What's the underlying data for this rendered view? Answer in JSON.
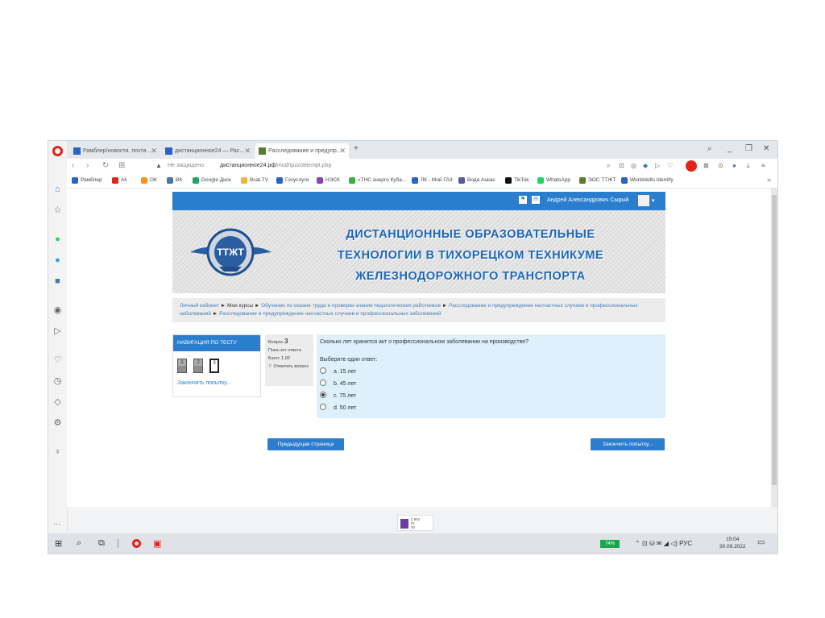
{
  "browser": {
    "tabs": [
      {
        "label": "Рамблер/новости, почта ..."
      },
      {
        "label": "дистанционное24 — Рас..."
      },
      {
        "label": "Расследование и предупр..."
      }
    ],
    "address": {
      "not_secure": "Не защищено",
      "url_domain": "дистанционное24.рф",
      "url_path": "/mod/quiz/attempt.php"
    },
    "bookmarks": [
      {
        "label": "Рамблер",
        "color": "#2c62c4"
      },
      {
        "label": "Ali",
        "color": "#e2231a"
      },
      {
        "label": "ОК",
        "color": "#f7931e"
      },
      {
        "label": "ВК",
        "color": "#4a76a8"
      },
      {
        "label": "Google Диск",
        "color": "#1fa463"
      },
      {
        "label": "Bsat.TV",
        "color": "#f2b632"
      },
      {
        "label": "Госуслуги",
        "color": "#2c62c4"
      },
      {
        "label": "НЭСК",
        "color": "#8e44ad"
      },
      {
        "label": "«ТНС энерго Куба...",
        "color": "#3cb043"
      },
      {
        "label": "ЛК - Мой ГАЗ",
        "color": "#2c62c4"
      },
      {
        "label": "Вода Анкас",
        "color": "#5b5b9c"
      },
      {
        "label": "TikTok",
        "color": "#111111"
      },
      {
        "label": "WhatsApp",
        "color": "#25d366"
      },
      {
        "label": "ЭОС ТТЖТ",
        "color": "#5a7d2a"
      },
      {
        "label": "Worldskills Identify",
        "color": "#2c62c4"
      }
    ]
  },
  "site": {
    "user_name": "Андрей Александрович Сырый",
    "banner_title": [
      "ДИСТАНЦИОННЫЕ ОБРАЗОВАТЕЛЬНЫЕ",
      "ТЕХНОЛОГИИ В ТИХОРЕЦКОМ ТЕХНИКУМЕ",
      "ЖЕЛЕЗНОДОРОЖНОГО ТРАНСПОРТА"
    ],
    "logo_text": "ТТЖТ",
    "breadcrumb": {
      "home": "Личный кабинет",
      "my_courses": "Мои курсы",
      "course": "Обучение по охране труда и проверки знания педагогических работников",
      "section": "Расследование и предупреждение несчастных случаев и профессиональных заболеваний",
      "page": "Расследование и предупреждение несчастных случаев и профессиональных заболеваний"
    },
    "accent": "#2b7dce"
  },
  "quiz": {
    "nav_title": "НАВИГАЦИЯ ПО ТЕСТУ",
    "nav_buttons": [
      "1",
      "2",
      "3"
    ],
    "finish_link": "Закончить попытку...",
    "question_label": "Вопрос",
    "question_number": "3",
    "status": "Пока нет ответа",
    "score": "Балл: 1,00",
    "flag": "Отметить вопрос",
    "question_text": "Сколько лет хранится акт о профессиональном заболевании на производстве?",
    "pick_one": "Выберите один ответ:",
    "options": [
      "a. 15 лет",
      "b. 45 лет",
      "c. 75 лет",
      "d. 50 лет"
    ],
    "selected_option": "c. 75 лет",
    "prev_button": "Предыдущая страница",
    "finish_button": "Закончить попытку..."
  },
  "download": {
    "line1": "2 652",
    "line2": "01",
    "line3": "00"
  },
  "taskbar": {
    "battery": "74%",
    "lang": "РУС",
    "time": "15:04",
    "date": "30.09.2022"
  }
}
